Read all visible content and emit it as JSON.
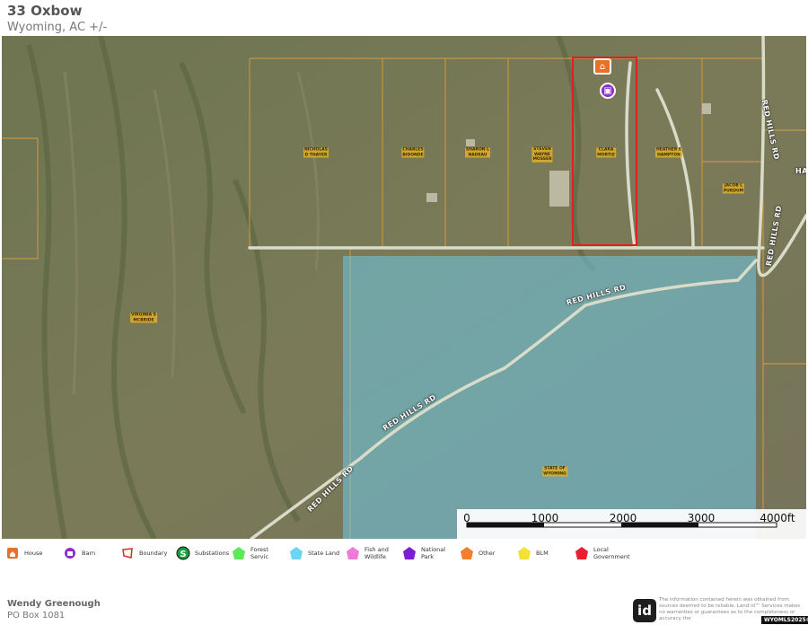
{
  "header": {
    "title": "33 Oxbow",
    "subtitle": "Wyoming,  AC +/-"
  },
  "map": {
    "parcel_owners": [
      {
        "id": "nicholas",
        "name": "NICHOLAS\nD THAYER"
      },
      {
        "id": "charles",
        "name": "CHARLES\nBIDONDE"
      },
      {
        "id": "sharon",
        "name": "SHARON L\nNADEAU"
      },
      {
        "id": "steven",
        "name": "STEVEN\nWAYNE\nMOSSER"
      },
      {
        "id": "clara",
        "name": "CLARA\nMORTIZ"
      },
      {
        "id": "heather",
        "name": "HEATHER E\nHAMPTON"
      },
      {
        "id": "jacob",
        "name": "JACOB L\nPURDUM"
      },
      {
        "id": "virginia",
        "name": "VIRGINIA S\nMCBRIDE"
      },
      {
        "id": "state",
        "name": "STATE OF\nWYOMING"
      }
    ],
    "road_labels": {
      "red_hills_1": "RED HILLS RD",
      "red_hills_2": "RED HILLS RD",
      "red_hills_3": "RED HILLS RD",
      "red_hills_4": "RED HILLS RD",
      "red_hills_5": "RED HILLS RD",
      "ha": "HA"
    },
    "colors": {
      "boundary": "#e02020",
      "state_land": "#6fc8e6",
      "parcel_lines": "#e8a33a",
      "road": "#d9dcc9"
    }
  },
  "scalebar": {
    "labels": [
      "0",
      "1000",
      "2000",
      "3000",
      "4000ft"
    ]
  },
  "legend": {
    "items": [
      {
        "label": "House",
        "icon": "house-icon",
        "color": "#e8702a"
      },
      {
        "label": "Barn",
        "icon": "barn-icon",
        "color": "#8c2cc9"
      },
      {
        "label": "Boundary",
        "icon": "boundary-icon",
        "color": "#d03030"
      },
      {
        "label": "Substations",
        "icon": "substation-icon",
        "color": "#1a9e3a"
      },
      {
        "label": "Forest Servic",
        "icon": "forest-service-icon",
        "color": "#5ee85a"
      },
      {
        "label": "State Land",
        "icon": "state-land-icon",
        "color": "#6fd3f5"
      },
      {
        "label": "Fish and Wildlife",
        "icon": "fish-wildlife-icon",
        "color": "#f07ad8"
      },
      {
        "label": "National Park",
        "icon": "national-park-icon",
        "color": "#7b1fd0"
      },
      {
        "label": "Other",
        "icon": "other-icon",
        "color": "#f08030"
      },
      {
        "label": "BLM",
        "icon": "blm-icon",
        "color": "#f5e03a"
      },
      {
        "label": "Local Government",
        "icon": "local-government-icon",
        "color": "#e82030"
      }
    ]
  },
  "footer": {
    "agent_name": "Wendy Greenough",
    "address": "PO Box 1081",
    "logo": "id",
    "disclaimer": "The information contained herein was obtained from sources deemed to be reliable. Land id™ Services makes no warranties or guarantees as to the completeness or accuracy the",
    "mls": "WYOMLS2025©"
  }
}
